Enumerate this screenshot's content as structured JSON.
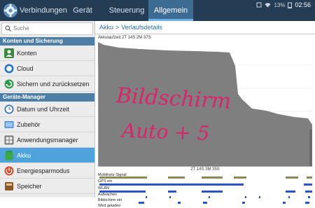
{
  "colors": {
    "accent": "#3c6b93",
    "section": "#4c7ea6",
    "selected": "#4fa3dc",
    "graph_fill": "#7f7f7f",
    "signal": "#8a8a58",
    "gps": "#2b54c9",
    "wifi": "#2b54c9",
    "annotation": "#e0206a"
  },
  "status": {
    "battery": "13%",
    "time": "02:56"
  },
  "tabs": [
    {
      "label": "Verbindungen"
    },
    {
      "label": "Gerät"
    },
    {
      "label": "Steuerung"
    },
    {
      "label": "Allgemein",
      "active": true
    }
  ],
  "sidebar": {
    "search_placeholder": "Suche",
    "section1": "Konten und Sicherung",
    "section2": "Geräte-Manager",
    "items": [
      {
        "label": "Konten",
        "icon": "accounts-icon"
      },
      {
        "label": "Cloud",
        "icon": "cloud-icon"
      },
      {
        "label": "Sichern und zurücksetzen",
        "icon": "backup-icon"
      },
      {
        "label": "Datum und Uhrzeit",
        "icon": "clock-icon"
      },
      {
        "label": "Zubehör",
        "icon": "accessory-icon"
      },
      {
        "label": "Anwendungsmanager",
        "icon": "apps-icon"
      },
      {
        "label": "Akku",
        "icon": "battery-icon",
        "selected": true
      },
      {
        "label": "Energiesparmodus",
        "icon": "power-saving-icon"
      },
      {
        "label": "Speicher",
        "icon": "storage-icon"
      }
    ]
  },
  "main": {
    "breadcrumb_parent": "Akku",
    "breadcrumb_current": "Verlaufsdetails",
    "battery_runtime": "Akkulaufzeit 2T 14S 2M 37S",
    "mid_time": "2T 14S 3M 35S",
    "annotation_line1": "Bildschirm",
    "annotation_line2": "Auto + 5",
    "rows": [
      "Mobilnetz-Signal",
      "GPS ein",
      "WLAN",
      "Aufwachen",
      "Bildschirm ein",
      "Wird geladen"
    ]
  }
}
